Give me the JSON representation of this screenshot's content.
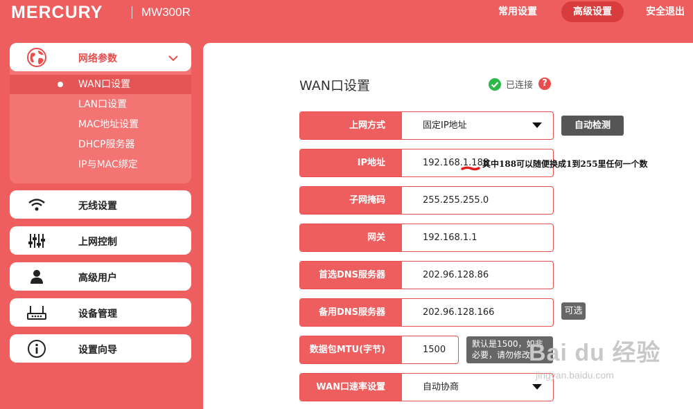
{
  "header": {
    "brand": "MERCURY",
    "model": "MW300R",
    "nav": [
      "常用设置",
      "高级设置",
      "安全退出"
    ],
    "active_nav": 1
  },
  "sidebar": {
    "group": {
      "label": "网络参数",
      "icon": "globe-icon",
      "items": [
        "WAN口设置",
        "LAN口设置",
        "MAC地址设置",
        "DHCP服务器",
        "IP与MAC绑定"
      ],
      "active_item": 0
    },
    "cards": [
      {
        "label": "无线设置",
        "icon": "wifi-icon"
      },
      {
        "label": "上网控制",
        "icon": "sliders-icon"
      },
      {
        "label": "高级用户",
        "icon": "user-icon"
      },
      {
        "label": "设备管理",
        "icon": "router-icon"
      },
      {
        "label": "设置向导",
        "icon": "info-icon"
      }
    ]
  },
  "main": {
    "title": "WAN口设置",
    "status": "已连接",
    "help": "?",
    "auto_detect": "自动检测",
    "optional": "可选",
    "mtu_tip": "默认是1500，如非必要，请勿修改",
    "annotation": "其中188可以随便换成1到255里任何一个数",
    "fields": [
      {
        "label": "上网方式",
        "value": "固定IP地址"
      },
      {
        "label": "IP地址",
        "value": "192.168.1.188"
      },
      {
        "label": "子网掩码",
        "value": "255.255.255.0"
      },
      {
        "label": "网关",
        "value": "192.168.1.1"
      },
      {
        "label": "首选DNS服务器",
        "value": "202.96.128.86"
      },
      {
        "label": "备用DNS服务器",
        "value": "202.96.128.166"
      },
      {
        "label": "数据包MTU(字节)",
        "value": "1500"
      },
      {
        "label": "WAN口速率设置",
        "value": "自动协商"
      }
    ]
  },
  "watermark": {
    "main": "Bai du 经验",
    "sub": "jingyan.baidu.com"
  },
  "colors": {
    "brand_red": "#ee5e5e",
    "dark_button": "#555555",
    "success_green": "#2fb84a"
  }
}
